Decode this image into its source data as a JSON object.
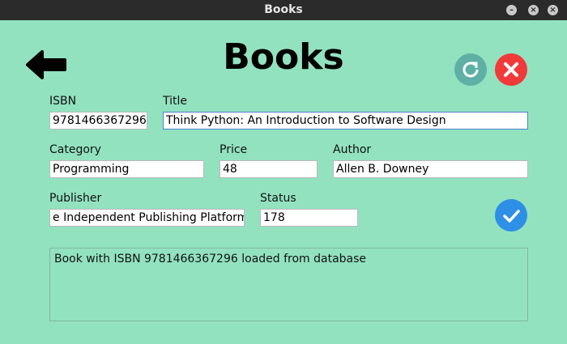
{
  "window": {
    "title": "Books"
  },
  "header": {
    "title": "Books"
  },
  "fields": {
    "isbn": {
      "label": "ISBN",
      "value": "9781466367296"
    },
    "title": {
      "label": "Title",
      "value": "Think Python: An Introduction to Software Design"
    },
    "category": {
      "label": "Category",
      "value": "Programming"
    },
    "price": {
      "label": "Price",
      "value": "48"
    },
    "author": {
      "label": "Author",
      "value": "Allen B. Downey"
    },
    "publisher": {
      "label": "Publisher",
      "value": "e Independent Publishing Platform"
    },
    "status": {
      "label": "Status",
      "value": "178"
    }
  },
  "output": {
    "message": "Book with ISBN 9781466367296 loaded from database"
  },
  "colors": {
    "background": "#92e2c0",
    "refresh_button": "#5fb0a4",
    "close_button": "#f03a3a",
    "confirm_button": "#2d8fe6"
  },
  "icons": {
    "back": "arrow-left-icon",
    "refresh": "refresh-icon",
    "close": "close-icon",
    "confirm": "checkmark-icon"
  }
}
